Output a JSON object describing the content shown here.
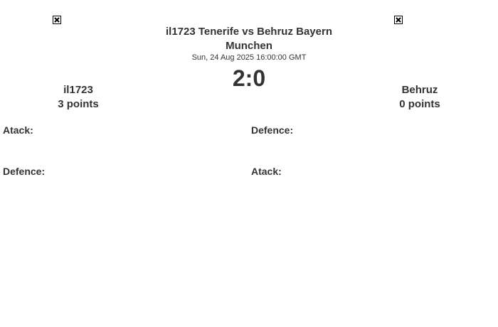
{
  "match": {
    "title": "il1723 Tenerife vs Behruz Bayern Munchen",
    "date": "Sun, 24 Aug 2025 16:00:00 GMT",
    "score": "2:0"
  },
  "home": {
    "name": "il1723",
    "points": "3 points",
    "logo_icon": "broken-image-icon",
    "atack_label": "Atack:",
    "defence_label": "Defence:"
  },
  "away": {
    "name": "Behruz",
    "points": "0 points",
    "logo_icon": "broken-image-icon",
    "defence_label": "Defence:",
    "atack_label": "Atack:"
  }
}
